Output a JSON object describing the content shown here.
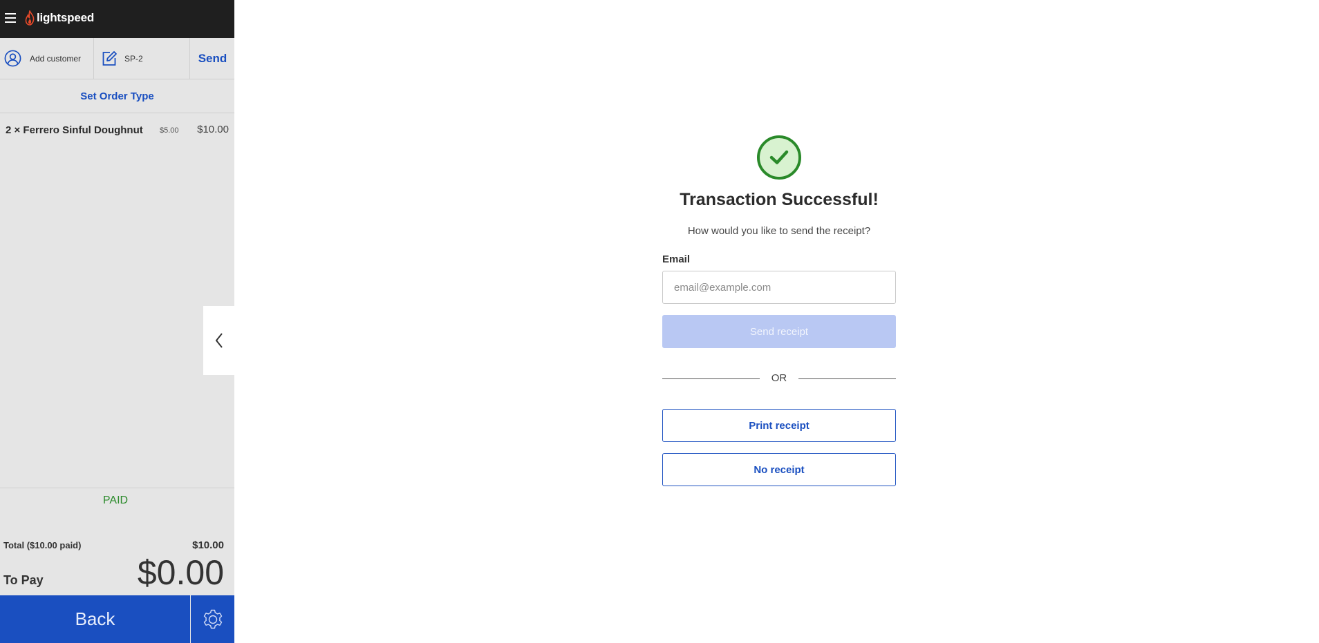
{
  "header": {
    "logo_text": "lightspeed",
    "menu_icon": "hamburger-menu-icon",
    "logo_icon": "flame-logo-icon"
  },
  "order_bar": {
    "add_customer_label": "Add customer",
    "order_ref_label": "SP-2",
    "send_label": "Send"
  },
  "order_type": {
    "label": "Set Order Type"
  },
  "items": [
    {
      "qty_name": "2 × Ferrero Sinful Doughnut",
      "unit_price": "$5.00",
      "line_total": "$10.00"
    }
  ],
  "summary": {
    "status": "PAID",
    "total_label": "Total ($10.00 paid)",
    "total_amount": "$10.00",
    "to_pay_label": "To Pay",
    "to_pay_amount": "$0.00"
  },
  "footer": {
    "back_label": "Back",
    "settings_icon": "gear-icon"
  },
  "receipt": {
    "title": "Transaction Successful!",
    "subtitle": "How would you like to send the receipt?",
    "email_label": "Email",
    "email_placeholder": "email@example.com",
    "email_value": "",
    "send_label": "Send receipt",
    "or_label": "OR",
    "print_label": "Print receipt",
    "no_label": "No receipt"
  },
  "colors": {
    "accent": "#1a4fc0",
    "success": "#2a8a2a",
    "topbar": "#1f1f1f",
    "panel": "#e5e5e5",
    "send_disabled": "#b9c8f3"
  }
}
